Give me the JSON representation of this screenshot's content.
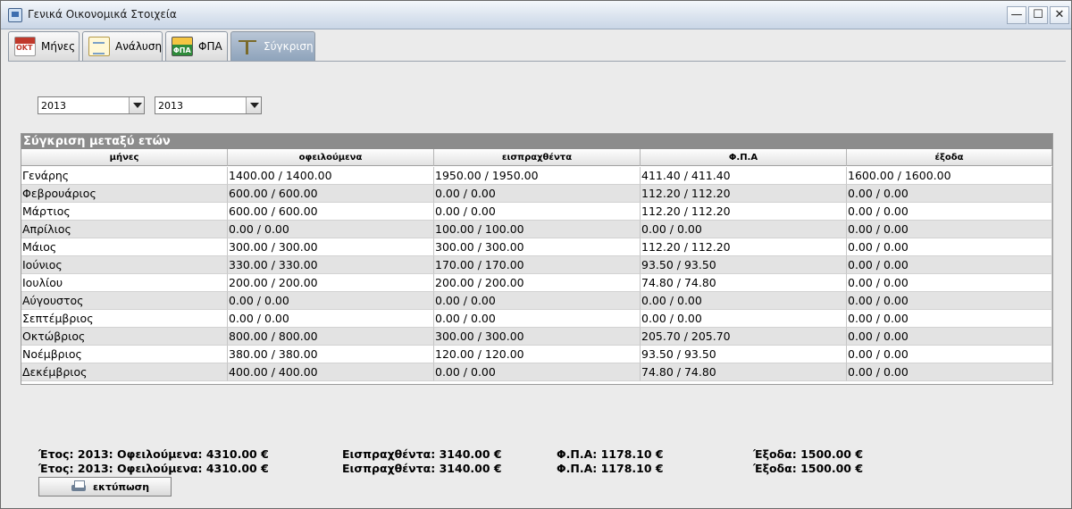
{
  "window": {
    "title": "Γενικά Οικονομικά Στοιχεία",
    "min_glyph": "—",
    "max_glyph": "☐",
    "close_glyph": "✕"
  },
  "tabs": [
    {
      "label": "Μήνες",
      "icon": "calendar-icon"
    },
    {
      "label": "Ανάλυση",
      "icon": "document-chart-icon"
    },
    {
      "label": "ΦΠΑ",
      "icon": "vat-icon"
    },
    {
      "label": "Σύγκριση",
      "icon": "scales-icon",
      "active": true
    }
  ],
  "filters": {
    "year_a": "2013",
    "year_b": "2013"
  },
  "table": {
    "title": "Σύγκριση μεταξύ ετών",
    "columns": [
      "μήνες",
      "οφειλούμενα",
      "εισπραχθέντα",
      "Φ.Π.Α",
      "έξοδα"
    ],
    "rows": [
      [
        "Γενάρης",
        "1400.00 / 1400.00",
        "1950.00 / 1950.00",
        "411.40 / 411.40",
        "1600.00 / 1600.00"
      ],
      [
        "Φεβρουάριος",
        "600.00 / 600.00",
        "0.00 / 0.00",
        "112.20 / 112.20",
        "0.00 / 0.00"
      ],
      [
        "Μάρτιος",
        "600.00 / 600.00",
        "0.00 / 0.00",
        "112.20 / 112.20",
        "0.00 / 0.00"
      ],
      [
        "Απρίλιος",
        "0.00 / 0.00",
        "100.00 / 100.00",
        "0.00 / 0.00",
        "0.00 / 0.00"
      ],
      [
        "Μάιος",
        "300.00 / 300.00",
        "300.00 / 300.00",
        "112.20 / 112.20",
        "0.00 / 0.00"
      ],
      [
        "Ιούνιος",
        "330.00 / 330.00",
        "170.00 / 170.00",
        "93.50 / 93.50",
        "0.00 / 0.00"
      ],
      [
        "Ιουλίου",
        "200.00 / 200.00",
        "200.00 / 200.00",
        "74.80 / 74.80",
        "0.00 / 0.00"
      ],
      [
        "Αύγουστος",
        "0.00 / 0.00",
        "0.00 / 0.00",
        "0.00 / 0.00",
        "0.00 / 0.00"
      ],
      [
        "Σεπτέμβριος",
        "0.00 / 0.00",
        "0.00 / 0.00",
        "0.00 / 0.00",
        "0.00 / 0.00"
      ],
      [
        "Οκτώβριος",
        "800.00 / 800.00",
        "300.00 / 300.00",
        "205.70 / 205.70",
        "0.00 / 0.00"
      ],
      [
        "Νοέμβριος",
        "380.00 / 380.00",
        "120.00 / 120.00",
        "93.50 / 93.50",
        "0.00 / 0.00"
      ],
      [
        "Δεκέμβριος",
        "400.00 / 400.00",
        "0.00 / 0.00",
        "74.80 / 74.80",
        "0.00 / 0.00"
      ]
    ]
  },
  "summary": [
    {
      "year": "Έτος: 2013: Οφειλούμενα: 4310.00 €",
      "received": "Εισπραχθέντα: 3140.00 €",
      "vat": "Φ.Π.Α: 1178.10 €",
      "expenses": "Έξοδα: 1500.00 €"
    },
    {
      "year": "Έτος: 2013: Οφειλούμενα: 4310.00 €",
      "received": "Εισπραχθέντα: 3140.00 €",
      "vat": "Φ.Π.Α: 1178.10 €",
      "expenses": "Έξοδα: 1500.00 €"
    }
  ],
  "actions": {
    "print_label": "εκτύπωση"
  },
  "colors": {
    "table_header_bar": "#8c8c8c",
    "row_alt": "#e3e3e3",
    "active_tab": "#8ea3bb"
  }
}
